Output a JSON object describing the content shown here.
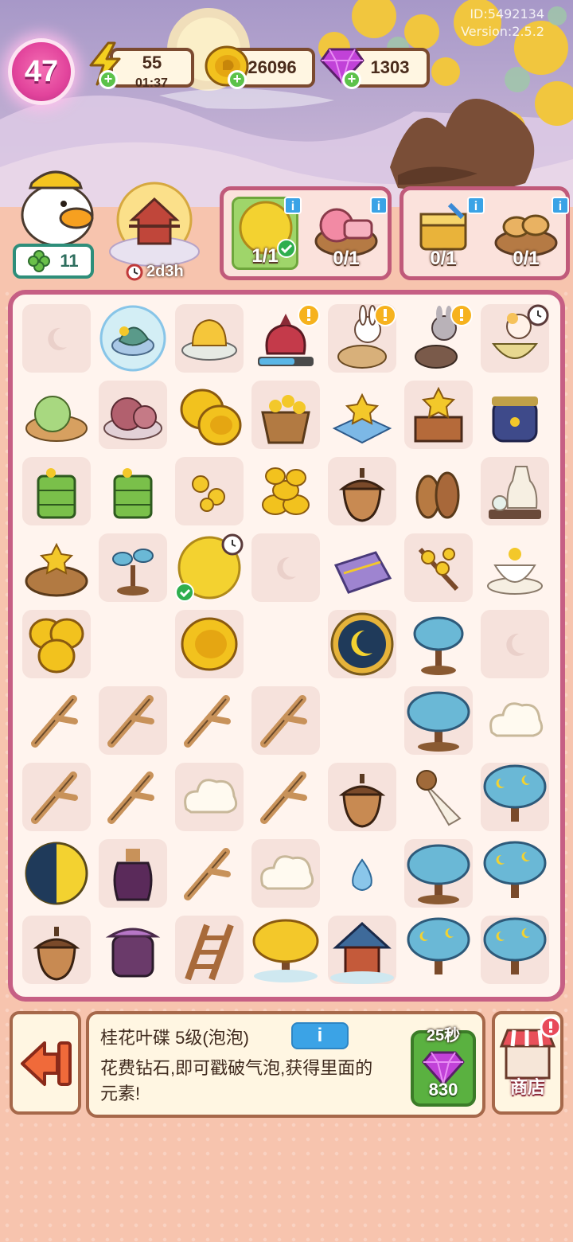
{
  "meta": {
    "id_text": "ID:5492134",
    "version_text": "Version:2.5.2"
  },
  "player": {
    "level": "47"
  },
  "resources": {
    "energy": {
      "value": "55",
      "timer": "01:37",
      "icon": "lightning-icon"
    },
    "coins": {
      "value": "26096",
      "icon": "coin-icon"
    },
    "gems": {
      "value": "1303",
      "icon": "gem-icon"
    }
  },
  "helper": {
    "count": "11",
    "icon": "clover-icon"
  },
  "event": {
    "timer": "2d3h",
    "icon": "pagoda-moon-icon"
  },
  "orders": [
    {
      "count": "1/1",
      "done": true
    },
    {
      "count": "0/1",
      "done": false
    },
    {
      "count": "0/1",
      "done": false
    },
    {
      "count": "0/1",
      "done": false
    }
  ],
  "selected_item": {
    "title": "桂花叶碟 5级(泡泡)",
    "info_label": "i",
    "description": "花费钻石,即可戳破气泡,获得里面的元素!",
    "pop_timer": "25秒",
    "pop_cost": "830"
  },
  "shop": {
    "label": "商店"
  },
  "colors": {
    "board_border": "#c65f84",
    "level_badge": "#e2449c",
    "button_green": "#5ab140"
  }
}
